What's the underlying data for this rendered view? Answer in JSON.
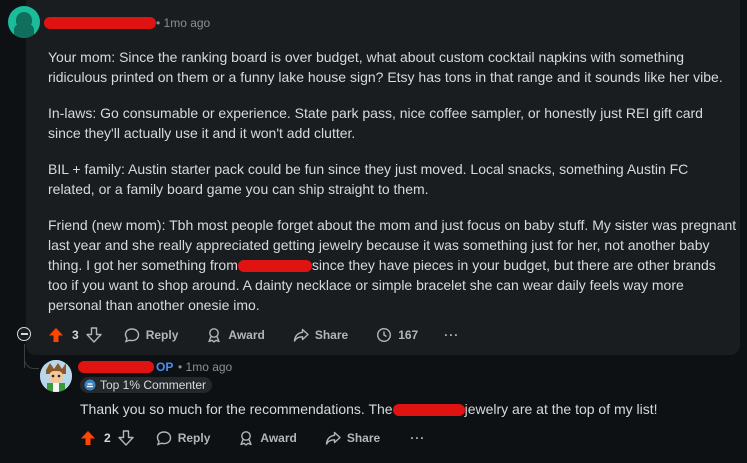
{
  "comment": {
    "time": "• 1mo ago",
    "paragraphs": [
      "Your mom: Since the ranking board is over budget, what about custom cocktail napkins with something ridiculous printed on them or a funny lake house sign? Etsy has tons in that range and it sounds like her vibe.",
      "In-laws: Go consumable or experience. State park pass, nice coffee sampler, or honestly just REI gift card since they'll actually use it and it won't add clutter.",
      "BIL + family: Austin starter pack could be fun since they just moved. Local snacks, something Austin FC related, or a family board game you can ship straight to them."
    ],
    "last_paragraph": {
      "before": "Friend (new mom): Tbh most people forget about the mom and just focus on baby stuff. My sister was pregnant last year and she really appreciated getting jewelry because it was something just for her, not another baby thing. I got her something from",
      "after": "since they have pieces in your budget, but there are other brands too if you want to shop around. A dainty necklace or simple bracelet she can wear daily feels way more personal than another onesie imo."
    },
    "actions": {
      "score": "3",
      "reply": "Reply",
      "award": "Award",
      "share": "Share",
      "views": "167",
      "more": "···"
    }
  },
  "reply": {
    "op_label": "OP",
    "time": "• 1mo ago",
    "badge": "Top 1% Commenter",
    "text_before": "Thank you so much for the recommendations. The",
    "text_after": "jewelry are at the top of my list!",
    "actions": {
      "score": "2",
      "reply": "Reply",
      "award": "Award",
      "share": "Share",
      "more": "···"
    }
  },
  "colors": {
    "upvote": "#ff4500",
    "op": "#4c8df6",
    "redaction": "#e01313",
    "card": "#1a1d1f",
    "background": "#0e1113"
  }
}
